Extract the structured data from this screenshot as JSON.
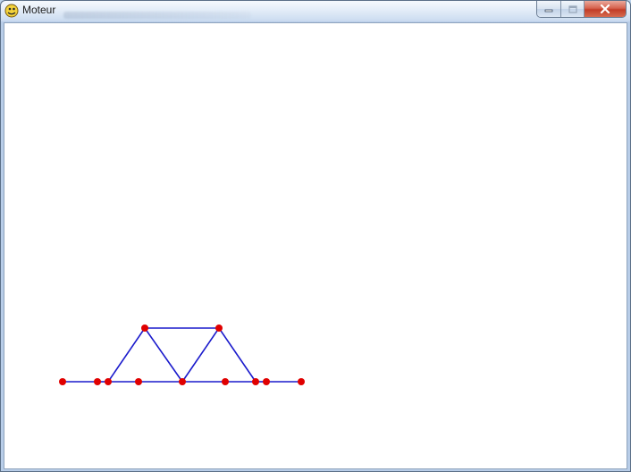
{
  "window": {
    "title": "Moteur"
  },
  "caption_buttons": [
    {
      "name": "minimize-button",
      "icon": "minimize-icon"
    },
    {
      "name": "maximize-button",
      "icon": "maximize-icon"
    },
    {
      "name": "close-button",
      "icon": "close-icon"
    }
  ],
  "colors": {
    "node": "#e00000",
    "bar": "#1a1acc",
    "canvas_background": "#ffffff"
  },
  "truss": {
    "nodes": [
      {
        "id": "n0"
      },
      {
        "id": "n1"
      },
      {
        "id": "n2"
      },
      {
        "id": "n3"
      },
      {
        "id": "n4"
      },
      {
        "id": "n5"
      },
      {
        "id": "n6"
      },
      {
        "id": "n7"
      },
      {
        "id": "n8"
      },
      {
        "id": "n9"
      },
      {
        "id": "n10"
      }
    ],
    "bars": [
      [
        "n0",
        "n1"
      ],
      [
        "n1",
        "n2"
      ],
      [
        "n2",
        "n3"
      ],
      [
        "n3",
        "n4"
      ],
      [
        "n4",
        "n5"
      ],
      [
        "n5",
        "n6"
      ],
      [
        "n6",
        "n7"
      ],
      [
        "n7",
        "n8"
      ],
      [
        "n2",
        "n9"
      ],
      [
        "n9",
        "n4"
      ],
      [
        "n9",
        "n10"
      ],
      [
        "n10",
        "n4"
      ],
      [
        "n10",
        "n6"
      ]
    ]
  }
}
